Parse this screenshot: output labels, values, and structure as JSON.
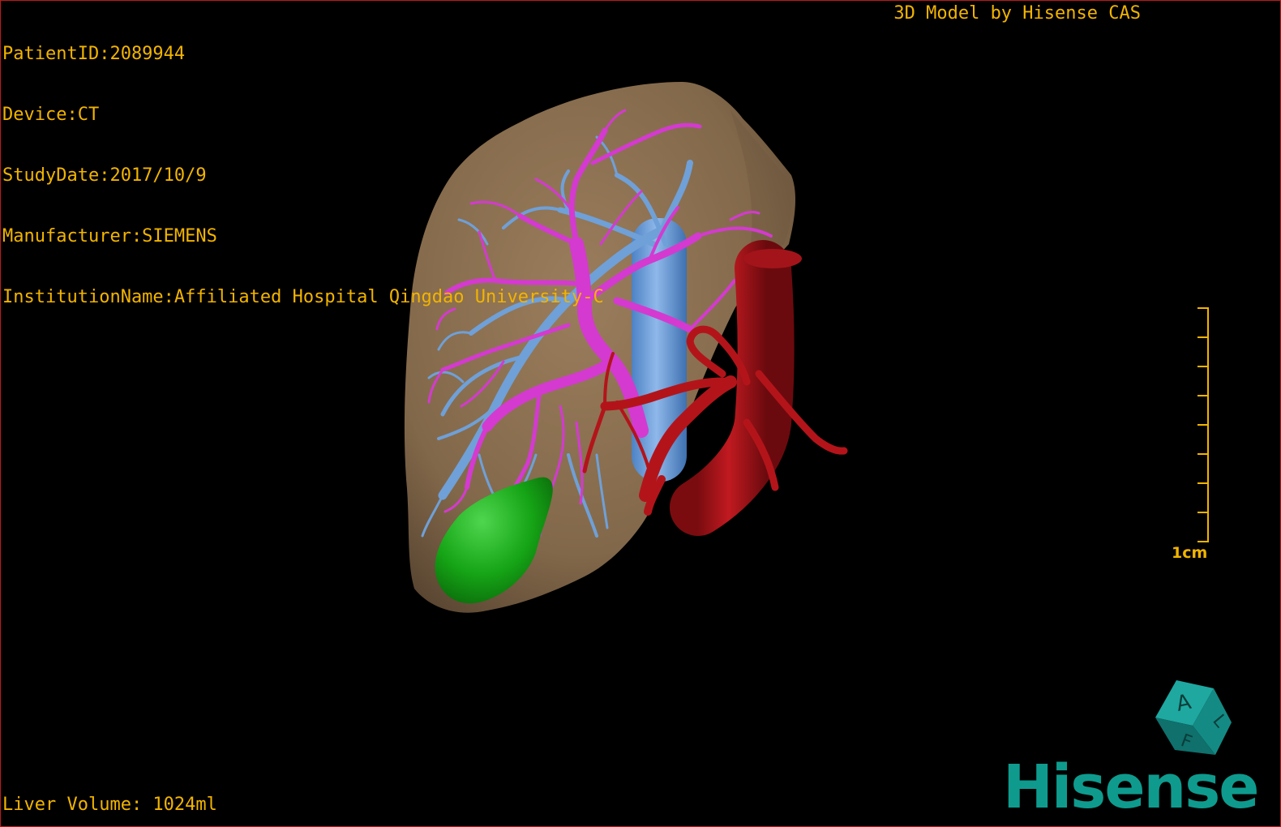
{
  "patient": {
    "patient_id_line": "PatientID:2089944",
    "device_line": "Device:CT",
    "study_date_line": "StudyDate:2017/10/9",
    "manufacturer_line": "Manufacturer:SIEMENS",
    "institution_line": "InstitutionName:Affiliated Hospital Qingdao University-C"
  },
  "header": {
    "brand_text": "3D Model by Hisense CAS"
  },
  "footer": {
    "liver_volume": "Liver Volume: 1024ml"
  },
  "scale": {
    "label": "1cm"
  },
  "orientation_cube": {
    "face_front": "A",
    "face_side": "L",
    "face_bottom": "F"
  },
  "logo": {
    "text": "Hisense"
  },
  "colors": {
    "overlay_text": "#f2b400",
    "liver": "#8b7052",
    "portal_vein": "#d43ad0",
    "hepatic_vein": "#6fa0d8",
    "artery": "#b3141a",
    "gallbladder": "#1aa81f",
    "logo": "#0e9b8e",
    "viewport_border": "#c41818"
  }
}
